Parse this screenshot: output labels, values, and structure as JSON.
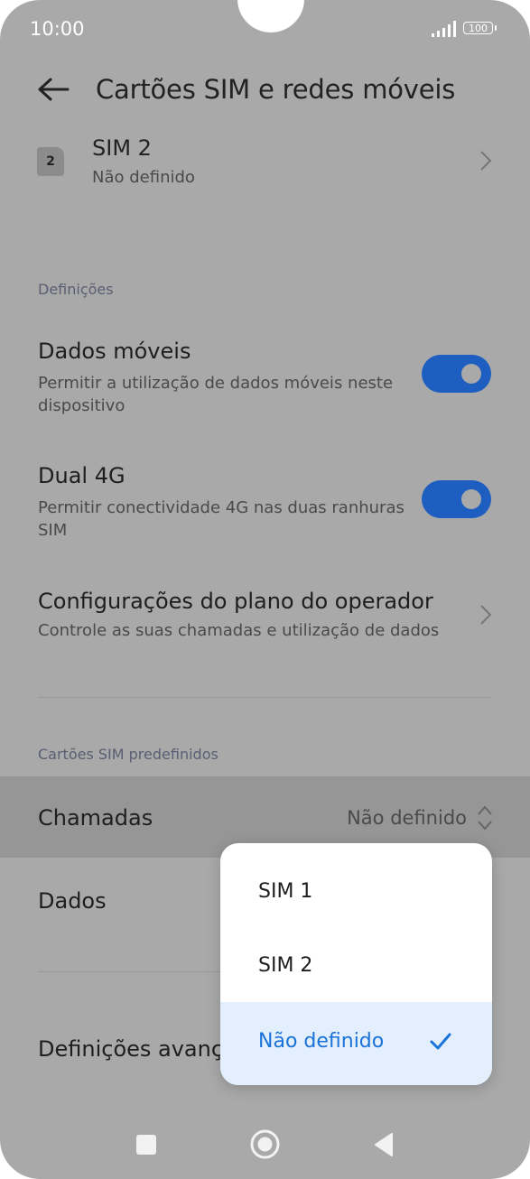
{
  "status_bar": {
    "time": "10:00",
    "battery": "100"
  },
  "header": {
    "title": "Cartões SIM e redes móveis",
    "back_icon": "arrow-left-icon"
  },
  "sim2": {
    "badge": "2",
    "title": "SIM 2",
    "subtitle": "Não definido"
  },
  "settings_section": {
    "label": "Definições",
    "items": [
      {
        "title": "Dados móveis",
        "subtitle": "Permitir a utilização de dados móveis neste dispositivo",
        "enabled": true
      },
      {
        "title": "Dual 4G",
        "subtitle": "Permitir conectividade 4G nas duas ranhuras SIM",
        "enabled": true
      },
      {
        "title": "Configurações do plano do operador",
        "subtitle": "Controle as suas chamadas e utilização de dados"
      }
    ]
  },
  "default_sim_section": {
    "label": "Cartões SIM predefinidos",
    "calls": {
      "label": "Chamadas",
      "value": "Não definido"
    },
    "data": {
      "label": "Dados"
    }
  },
  "advanced": {
    "label": "Definições avanç"
  },
  "popup": {
    "options": [
      {
        "label": "SIM 1",
        "selected": false
      },
      {
        "label": "SIM 2",
        "selected": false
      },
      {
        "label": "Não definido",
        "selected": true
      }
    ]
  },
  "colors": {
    "accent": "#1d5ec0",
    "selected_text": "#1a73d8",
    "selected_bg": "#e3effd"
  }
}
